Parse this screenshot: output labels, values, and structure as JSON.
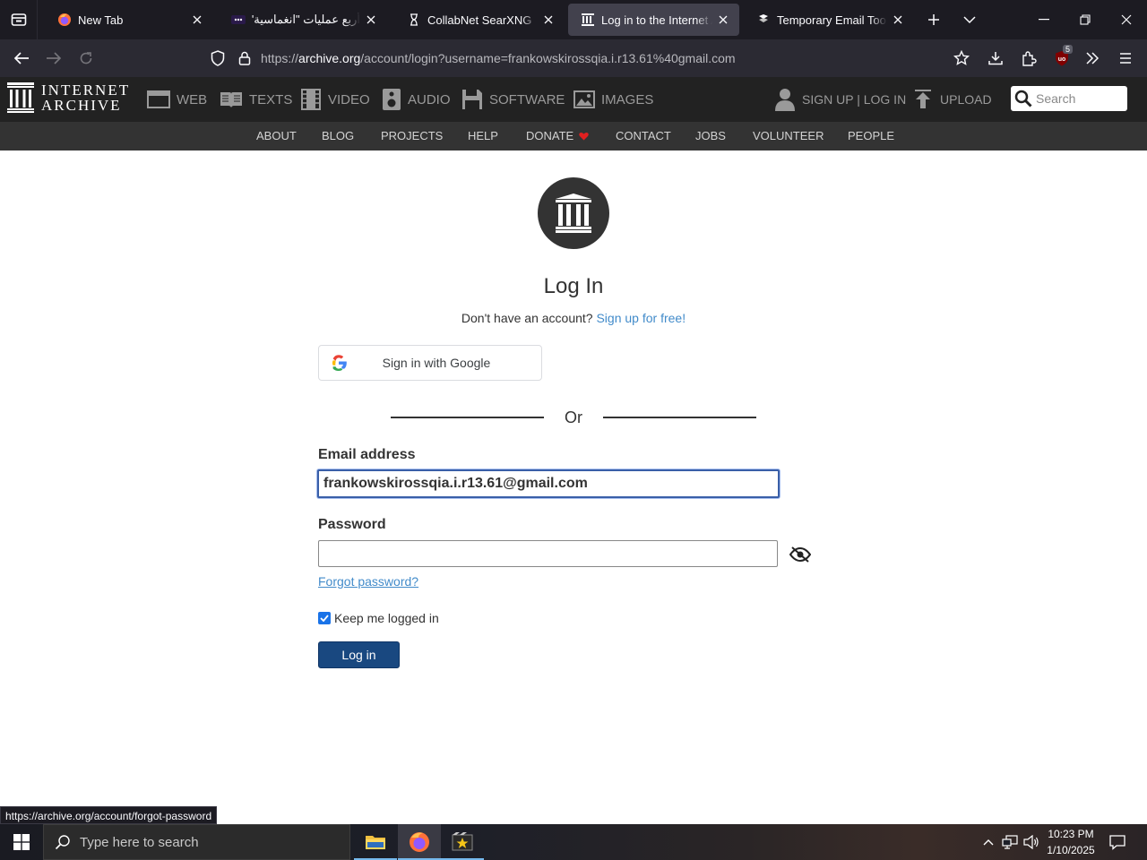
{
  "browser": {
    "tabs": [
      {
        "title": "New Tab",
        "favicon": "firefox-icon",
        "active": false
      },
      {
        "title": "أربع عمليات \"انغماسية\" لهـ",
        "favicon": "dots-icon",
        "active": false
      },
      {
        "title": "CollabNet SearXNG",
        "favicon": "hourglass-icon",
        "active": false
      },
      {
        "title": "Log in to the Internet Archive",
        "favicon": "archive-icon",
        "active": true
      },
      {
        "title": "Temporary Email Tools - Te",
        "favicon": "temp-mail-icon",
        "active": false
      }
    ],
    "url_prefix": "https://",
    "url_host": "archive.org",
    "url_path": "/account/login?username=frankowskirossqia.i.r13.61%40gmail.com",
    "extension_badge": "5",
    "status_link": "https://archive.org/account/forgot-password"
  },
  "ia_nav": {
    "logo_line1": "INTERNET",
    "logo_line2": "ARCHIVE",
    "media": [
      {
        "label": "WEB",
        "icon": "web-icon"
      },
      {
        "label": "TEXTS",
        "icon": "texts-icon"
      },
      {
        "label": "VIDEO",
        "icon": "video-icon"
      },
      {
        "label": "AUDIO",
        "icon": "audio-icon"
      },
      {
        "label": "SOFTWARE",
        "icon": "software-icon"
      },
      {
        "label": "IMAGES",
        "icon": "images-icon"
      }
    ],
    "signup_label": "SIGN UP | LOG IN",
    "upload_label": "UPLOAD",
    "search_placeholder": "Search",
    "sub_items": [
      "ABOUT",
      "BLOG",
      "PROJECTS",
      "HELP",
      "DONATE",
      "CONTACT",
      "JOBS",
      "VOLUNTEER",
      "PEOPLE"
    ]
  },
  "login": {
    "title": "Log In",
    "no_account_text": "Don't have an account?",
    "signup_link": "Sign up for free!",
    "google_label": "Sign in with Google",
    "or_text": "Or",
    "email_label": "Email address",
    "email_value": "frankowskirossqia.i.r13.61@gmail.com",
    "password_label": "Password",
    "password_value": "",
    "forgot_label": "Forgot password?",
    "keep_logged_label": "Keep me logged in",
    "keep_logged_checked": true,
    "login_button": "Log in"
  },
  "taskbar": {
    "search_placeholder": "Type here to search",
    "time": "10:23 PM",
    "date": "1/10/2025"
  },
  "colors": {
    "accent_link": "#428bca",
    "login_button": "#194880",
    "donate_heart": "#e02020"
  }
}
